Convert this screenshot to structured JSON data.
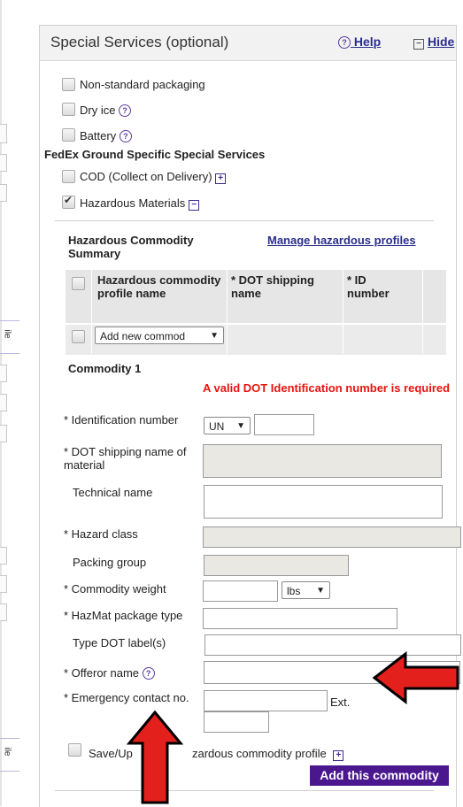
{
  "panel": {
    "title": "Special Services (optional)",
    "help_label": "Help",
    "hide_label": "Hide"
  },
  "left_edge": {
    "fragment_1": "ile",
    "fragment_2": "ile"
  },
  "options": {
    "non_standard_packaging": {
      "label": "Non-standard packaging",
      "checked": false
    },
    "dry_ice": {
      "label": "Dry ice",
      "checked": false
    },
    "battery": {
      "label": "Battery",
      "checked": false
    }
  },
  "ground_section": {
    "title": "FedEx Ground Specific Special Services",
    "cod": {
      "label": "COD (Collect on Delivery)",
      "checked": false
    },
    "hazmat": {
      "label": "Hazardous Materials",
      "checked": true
    }
  },
  "summary": {
    "title": "Hazardous Commodity Summary",
    "manage_link": "Manage hazardous profiles",
    "columns": [
      "Hazardous commodity profile name",
      "* DOT shipping name",
      "* ID number"
    ],
    "add_new_select": "Add new commod"
  },
  "commodity": {
    "title": "Commodity 1",
    "error": "A valid DOT Identification number is required",
    "id_number": {
      "label": "Identification number",
      "prefix_select": "UN",
      "value": ""
    },
    "dot_shipping_name": {
      "label": "DOT shipping name of material",
      "value": ""
    },
    "technical_name": {
      "label": "Technical name",
      "value": ""
    },
    "hazard_class": {
      "label": "Hazard class",
      "value": ""
    },
    "packing_group": {
      "label": "Packing group",
      "value": ""
    },
    "commodity_weight": {
      "label": "Commodity weight",
      "unit_select": "lbs",
      "value": ""
    },
    "hazmat_package_type": {
      "label": "HazMat package type",
      "value": ""
    },
    "type_dot_labels": {
      "label": "Type DOT label(s)",
      "value": ""
    },
    "offeror_name": {
      "label": "Offeror name",
      "value": ""
    },
    "emergency_contact": {
      "label": "Emergency contact no.",
      "ext_label": "Ext.",
      "value": "",
      "ext_value": ""
    },
    "save_profile": {
      "label_start": "Save/Up",
      "label_end": "zardous commodity profile",
      "checked": false
    },
    "add_button": "Add this commodity"
  },
  "colors": {
    "link": "#2a2e8c",
    "error": "#e8130d",
    "button": "#4b178f",
    "annotation_arrow": "#e3201b"
  },
  "icons": {
    "help": "help-circle-icon",
    "hide": "minus-box-icon",
    "expand": "plus-box-icon",
    "collapse": "minus-box-icon",
    "annotation": "red-arrow-icon"
  }
}
